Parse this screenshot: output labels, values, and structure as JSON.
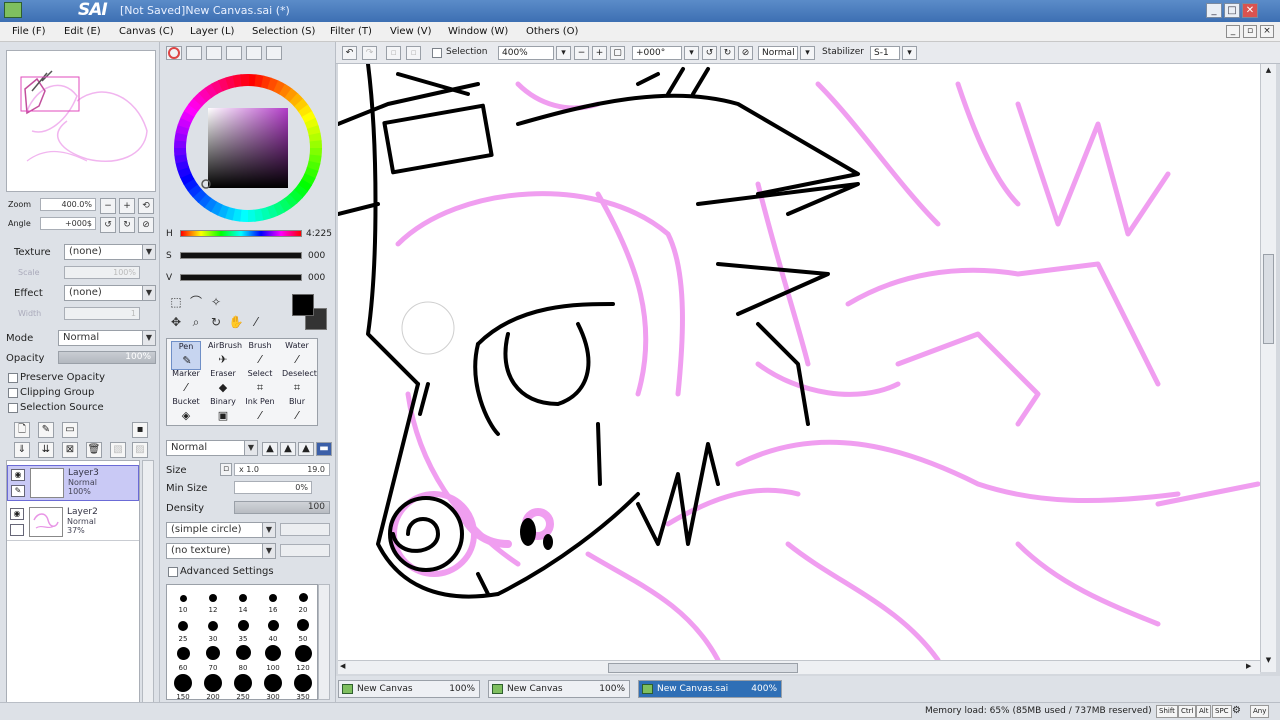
{
  "window": {
    "app_name": "SAI",
    "title": "[Not Saved]New Canvas.sai (*)",
    "buttons": {
      "minimize": "_",
      "maximize": "□",
      "close": "✕"
    }
  },
  "menu": {
    "items": [
      "File (F)",
      "Edit (E)",
      "Canvas (C)",
      "Layer (L)",
      "Selection (S)",
      "Filter (T)",
      "View (V)",
      "Window (W)",
      "Others (O)"
    ]
  },
  "navigator": {
    "zoom_label": "Zoom",
    "zoom_value": "400.0%",
    "angle_label": "Angle",
    "angle_value": "+000$"
  },
  "layer_props": {
    "texture_label": "Texture",
    "texture_value": "(none)",
    "scale_label": "Scale",
    "scale_value": "100%",
    "effect_label": "Effect",
    "effect_value": "(none)",
    "width_label": "Width",
    "width_value": "1",
    "mode_label": "Mode",
    "mode_value": "Normal",
    "opacity_label": "Opacity",
    "opacity_value": "100%",
    "preserve_opacity": "Preserve Opacity",
    "clipping_group": "Clipping Group",
    "selection_source": "Selection Source"
  },
  "layers": [
    {
      "name": "Layer3",
      "mode": "Normal",
      "opacity": "100%",
      "selected": true
    },
    {
      "name": "Layer2",
      "mode": "Normal",
      "opacity": "37%",
      "selected": false
    }
  ],
  "color": {
    "h_label": "H",
    "h_value": "4:225",
    "s_label": "S",
    "s_value": "000",
    "v_label": "V",
    "v_value": "000",
    "primary": "#000000",
    "accent": "#e07de0"
  },
  "tools": {
    "brushes": [
      {
        "label": "Pen",
        "icon": "pen-icon",
        "glyph": "✎",
        "selected": true
      },
      {
        "label": "AirBrush",
        "icon": "airbrush-icon",
        "glyph": "✈",
        "selected": false
      },
      {
        "label": "Brush",
        "icon": "brush-icon",
        "glyph": "⁄",
        "selected": false
      },
      {
        "label": "Water",
        "icon": "water-icon",
        "glyph": "⁄",
        "selected": false
      },
      {
        "label": "Marker",
        "icon": "marker-icon",
        "glyph": "⁄",
        "selected": false
      },
      {
        "label": "Eraser",
        "icon": "eraser-icon",
        "glyph": "◆",
        "selected": false
      },
      {
        "label": "Select",
        "icon": "select-icon",
        "glyph": "⌗",
        "selected": false
      },
      {
        "label": "Deselect",
        "icon": "deselect-icon",
        "glyph": "⌗",
        "selected": false
      },
      {
        "label": "Bucket",
        "icon": "bucket-icon",
        "glyph": "◈",
        "selected": false
      },
      {
        "label": "Binary",
        "icon": "binary-icon",
        "glyph": "▣",
        "selected": false
      },
      {
        "label": "Ink Pen",
        "icon": "ink-pen-icon",
        "glyph": "⁄",
        "selected": false
      },
      {
        "label": "Blur",
        "icon": "blur-icon",
        "glyph": "⁄",
        "selected": false
      }
    ],
    "blend_mode": "Normal",
    "size_label": "Size",
    "size_mult": "x 1.0",
    "size_value": "19.0",
    "min_size_label": "Min Size",
    "min_size_value": "0%",
    "density_label": "Density",
    "density_value": "100",
    "shape_value": "(simple circle)",
    "texture_value": "(no texture)",
    "advanced_settings": "Advanced Settings",
    "dot_sizes": [
      "10",
      "12",
      "14",
      "16",
      "20",
      "25",
      "30",
      "35",
      "40",
      "50",
      "60",
      "70",
      "80",
      "100",
      "120",
      "150",
      "200",
      "250",
      "300",
      "350"
    ]
  },
  "canvas_toolbar": {
    "selection_label": "Selection",
    "zoom_value": "400%",
    "angle_value": "+000°",
    "mode_value": "Normal",
    "stabilizer_label": "Stabilizer",
    "stabilizer_value": "S-1"
  },
  "tabs": [
    {
      "name": "New Canvas",
      "zoom": "100%",
      "active": false
    },
    {
      "name": "New Canvas",
      "zoom": "100%",
      "active": false
    },
    {
      "name": "New Canvas.sai",
      "zoom": "400%",
      "active": true
    }
  ],
  "status": {
    "memory": "Memory load: 65% (85MB used / 737MB reserved)",
    "keys": [
      "Shift",
      "Ctrl",
      "Alt",
      "SPC",
      "Any"
    ]
  }
}
